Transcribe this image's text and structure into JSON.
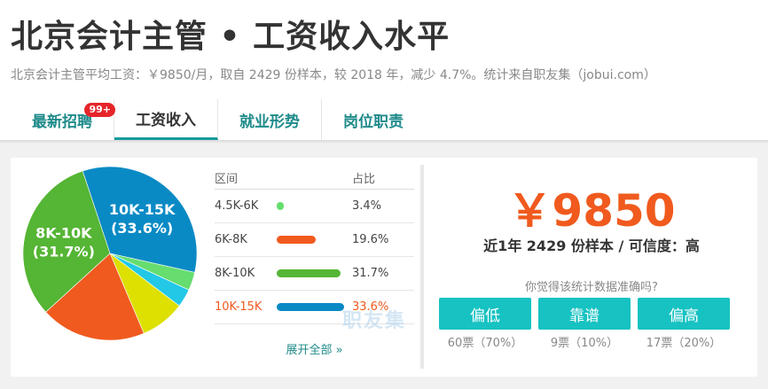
{
  "header": {
    "title": "北京会计主管 • 工资收入水平",
    "subtitle": "北京会计主管平均工资：￥9850/月，取自 2429 份样本，较 2018 年，减少 4.7%。统计来自职友集（jobui.com）"
  },
  "tabs": [
    {
      "label": "最新招聘",
      "badge": "99+"
    },
    {
      "label": "工资收入"
    },
    {
      "label": "就业形势"
    },
    {
      "label": "岗位职责"
    }
  ],
  "table": {
    "headers": [
      "区间",
      "占比"
    ],
    "rows": [
      {
        "range": "4.5K-6K",
        "percent": "3.4%",
        "value": 3.4,
        "color": "#66dd6e"
      },
      {
        "range": "6K-8K",
        "percent": "19.6%",
        "value": 19.6,
        "color": "#f05a1e"
      },
      {
        "range": "8K-10K",
        "percent": "31.7%",
        "value": 31.7,
        "color": "#55b534"
      },
      {
        "range": "10K-15K",
        "percent": "33.6%",
        "value": 33.6,
        "color": "#0a8ac5"
      }
    ],
    "expand": "展开全部 »",
    "watermark": "职友集"
  },
  "chart_data": {
    "type": "pie",
    "slices": [
      {
        "label": "10K-15K",
        "value": 33.6,
        "color": "#0a8ac5",
        "text": "10K-15K",
        "pct": "(33.6%)"
      },
      {
        "label": "4.5K-6K",
        "value": 3.4,
        "color": "#66dd6e"
      },
      {
        "label": "",
        "value": 3.4,
        "color": "#22c8e6"
      },
      {
        "label": "",
        "value": 8.3,
        "color": "#dde000"
      },
      {
        "label": "6K-8K",
        "value": 19.6,
        "color": "#f05a1e"
      },
      {
        "label": "8K-10K",
        "value": 31.7,
        "color": "#55b534",
        "text": "8K-10K",
        "pct": "(31.7%)"
      }
    ]
  },
  "summary": {
    "salary": "￥9850",
    "sample": "近1年 2429 份样本 / 可信度：高",
    "question": "你觉得该统计数据准确吗?"
  },
  "votes": [
    {
      "label": "偏低",
      "count": "60票（70%）"
    },
    {
      "label": "靠谱",
      "count": "9票（10%）"
    },
    {
      "label": "偏高",
      "count": "17票（20%）"
    }
  ]
}
